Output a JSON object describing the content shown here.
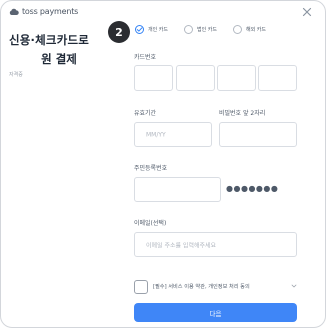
{
  "brand": {
    "logo_text": "toss payments"
  },
  "header": {
    "title_line1": "신용·체크카드로",
    "title_line2": "원 결제",
    "merchant_label": "자격증"
  },
  "step_badge": "2",
  "card_types": [
    {
      "label": "개인 카드",
      "selected": true
    },
    {
      "label": "법인 카드",
      "selected": false
    },
    {
      "label": "해외 카드",
      "selected": false
    }
  ],
  "form": {
    "card_number_label": "카드번호",
    "expiry_label": "유효기간",
    "expiry_placeholder": "MM/YY",
    "password_label": "비밀번호 앞 2자리",
    "rrn_label": "주민등록번호",
    "rrn_mask": "●●●●●●●",
    "email_label": "이메일(선택)",
    "email_placeholder": "이메일 주소를 입력해주세요"
  },
  "agreement": {
    "text": "[필수] 서비스 이용 약관, 개인정보 처리 동의"
  },
  "next_button": "다음",
  "colors": {
    "accent": "#3182f6",
    "button": "#3f86f7",
    "badge": "#2b2d31"
  }
}
